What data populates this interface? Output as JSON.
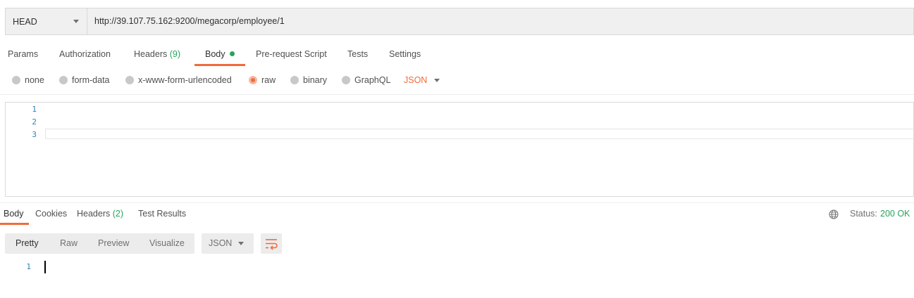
{
  "request": {
    "method": "HEAD",
    "url": "http://39.107.75.162:9200/megacorp/employee/1"
  },
  "request_tabs": {
    "params": "Params",
    "authorization": "Authorization",
    "headers": "Headers",
    "headers_count": "(9)",
    "body": "Body",
    "pre_request": "Pre-request Script",
    "tests": "Tests",
    "settings": "Settings"
  },
  "body_types": {
    "none": "none",
    "form_data": "form-data",
    "urlencoded": "x-www-form-urlencoded",
    "raw": "raw",
    "binary": "binary",
    "graphql": "GraphQL",
    "selected_format": "JSON",
    "selected": "raw"
  },
  "editor": {
    "line_numbers": [
      "1",
      "2",
      "3"
    ]
  },
  "response_tabs": {
    "body": "Body",
    "cookies": "Cookies",
    "headers": "Headers",
    "headers_count": "(2)",
    "test_results": "Test Results"
  },
  "status": {
    "label": "Status:",
    "value": "200 OK"
  },
  "view_modes": {
    "pretty": "Pretty",
    "raw": "Raw",
    "preview": "Preview",
    "visualize": "Visualize",
    "format": "JSON"
  },
  "response_editor": {
    "line_numbers": [
      "1"
    ]
  },
  "colors": {
    "accent": "#f26b3a",
    "success": "#27a35b",
    "line_number": "#2f7fb5"
  }
}
